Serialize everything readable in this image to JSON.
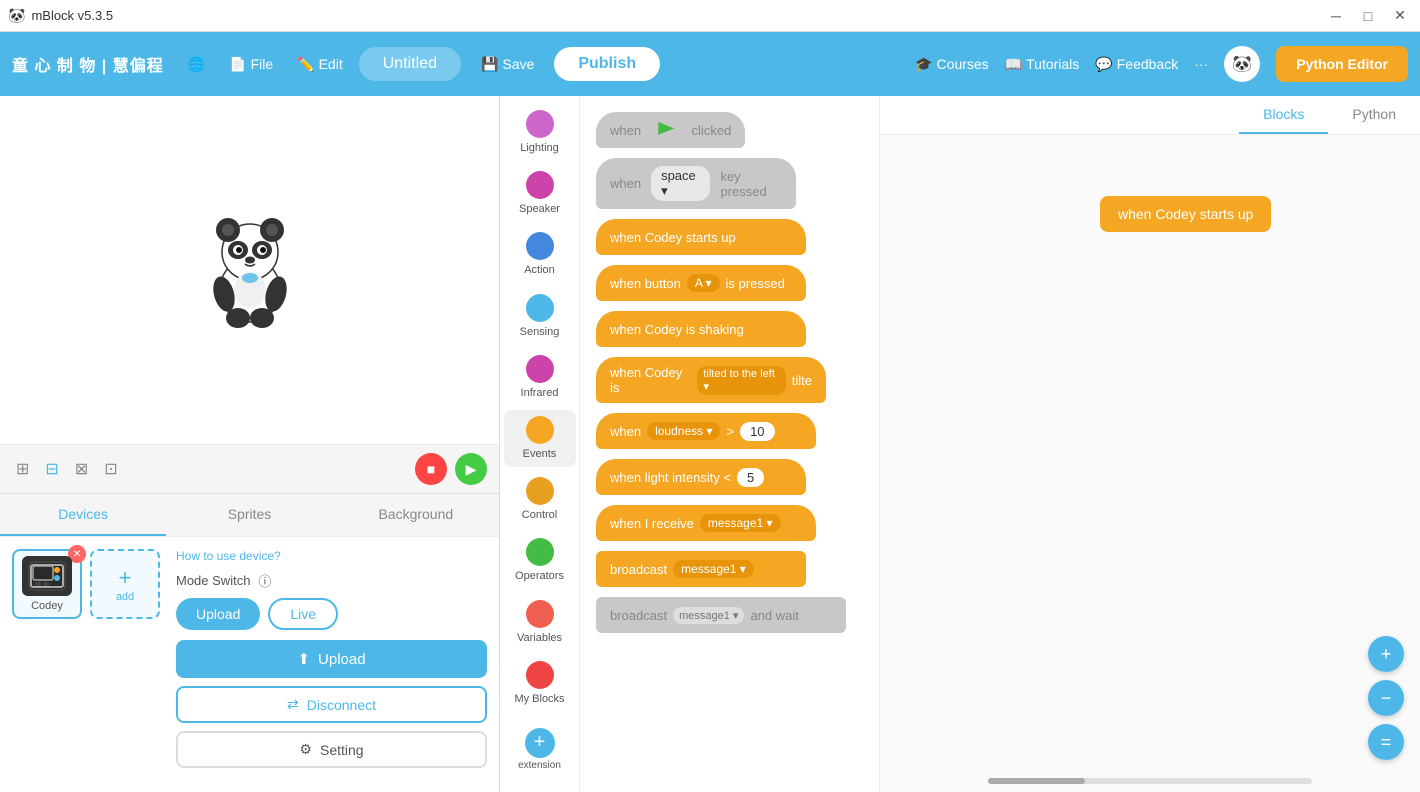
{
  "titlebar": {
    "app_name": "mBlock v5.3.5",
    "min_btn": "─",
    "max_btn": "□",
    "close_btn": "✕"
  },
  "toolbar": {
    "brand": "童 心 制 物 | 慧偏程",
    "globe_icon": "🌐",
    "file_label": "File",
    "edit_label": "Edit",
    "project_name": "Untitled",
    "save_label": "Save",
    "publish_label": "Publish",
    "courses_label": "Courses",
    "tutorials_label": "Tutorials",
    "feedback_label": "Feedback",
    "more_icon": "···",
    "python_editor_label": "Python Editor"
  },
  "palette": {
    "items": [
      {
        "id": "lighting",
        "label": "Lighting",
        "color": "#cc66cc"
      },
      {
        "id": "speaker",
        "label": "Speaker",
        "color": "#cc44aa"
      },
      {
        "id": "action",
        "label": "Action",
        "color": "#4488dd"
      },
      {
        "id": "sensing",
        "label": "Sensing",
        "color": "#4db8e8"
      },
      {
        "id": "infrared",
        "label": "Infrared",
        "color": "#cc44aa"
      },
      {
        "id": "events",
        "label": "Events",
        "color": "#f5a623"
      },
      {
        "id": "control",
        "label": "Control",
        "color": "#e8a020"
      },
      {
        "id": "operators",
        "label": "Operators",
        "color": "#44bb44"
      },
      {
        "id": "variables",
        "label": "Variables",
        "color": "#f06050"
      },
      {
        "id": "myblocks",
        "label": "My Blocks",
        "color": "#ee4444"
      }
    ],
    "add_label": "extension"
  },
  "blocks": [
    {
      "id": "when-flag",
      "type": "gray",
      "text": "when 🚩 clicked"
    },
    {
      "id": "when-key",
      "type": "gray",
      "text": "when space ▾ key pressed"
    },
    {
      "id": "when-codey-starts",
      "type": "yellow",
      "text": "when Codey starts up"
    },
    {
      "id": "when-button",
      "type": "yellow",
      "text": "when button  A ▾  is pressed"
    },
    {
      "id": "when-shaking",
      "type": "yellow",
      "text": "when Codey is shaking"
    },
    {
      "id": "when-tilted",
      "type": "yellow",
      "text": "when Codey is  tilted to the left ▾  tilte"
    },
    {
      "id": "when-loudness",
      "type": "yellow",
      "text": "when  loudness ▾  >  10"
    },
    {
      "id": "when-light",
      "type": "yellow",
      "text": "when light intensity <  5"
    },
    {
      "id": "when-receive",
      "type": "yellow",
      "text": "when I receive  message1 ▾"
    },
    {
      "id": "broadcast",
      "type": "yellow",
      "text": "broadcast  message1 ▾"
    },
    {
      "id": "broadcast-wait",
      "type": "gray",
      "text": "broadcast  message1 ▾  and wait"
    }
  ],
  "workspace": {
    "block_label": "when Codey starts up",
    "tab_blocks": "Blocks",
    "tab_python": "Python",
    "code_toggle": "</>"
  },
  "stage": {
    "tabs": [
      {
        "id": "devices",
        "label": "Devices",
        "active": true
      },
      {
        "id": "sprites",
        "label": "Sprites",
        "active": false
      },
      {
        "id": "background",
        "label": "Background",
        "active": false
      }
    ],
    "how_to_link": "How to use device?",
    "mode_switch": "Mode Switch",
    "mode_info_icon": "ⓘ",
    "upload_mode": "Upload",
    "live_mode": "Live",
    "upload_btn": "Upload",
    "disconnect_btn": "Disconnect",
    "setting_btn": "Setting",
    "device": {
      "name": "Codey",
      "add_label": "add"
    }
  },
  "zoom_btns": {
    "zoom_in": "+",
    "zoom_out": "−",
    "reset": "="
  }
}
